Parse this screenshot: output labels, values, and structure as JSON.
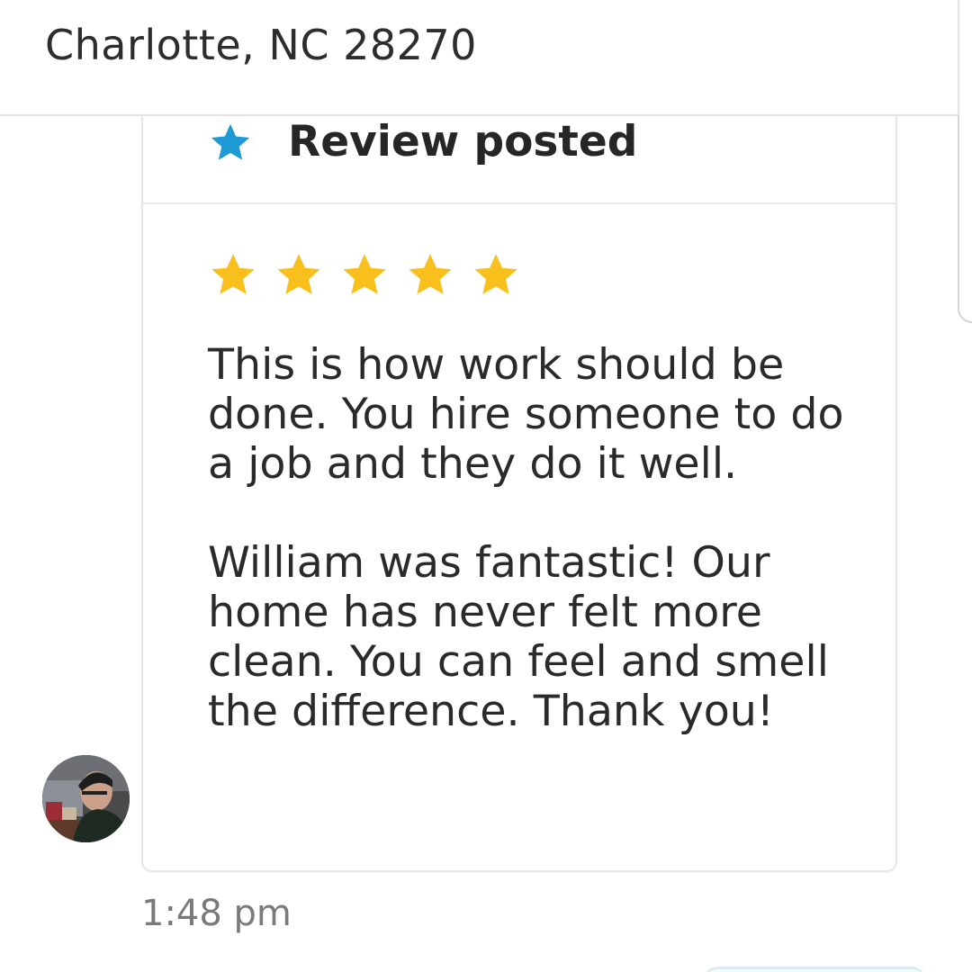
{
  "header": {
    "location": "Charlotte, NC 28270"
  },
  "review_card": {
    "title": "Review posted",
    "header_icon": "star-icon",
    "header_icon_color": "#1e9ad6",
    "rating": 5,
    "rating_max": 5,
    "rating_star_color": "#f9bf1c",
    "paragraph_1": "This is how work should be done. You hire someone to do a job and they do it well.",
    "paragraph_2": "William was fantastic! Our home has never felt more clean. You can feel and smell the difference. Thank you!"
  },
  "message": {
    "avatar": "user-avatar",
    "timestamp": "1:48 pm"
  }
}
